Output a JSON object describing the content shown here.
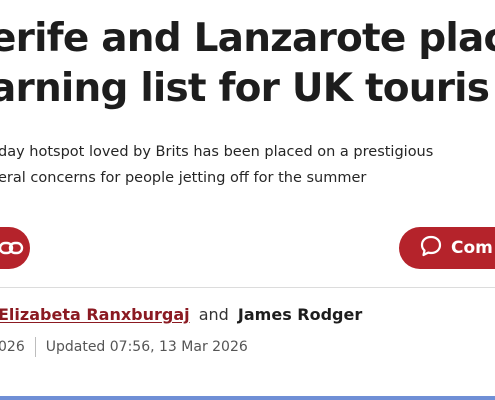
{
  "article": {
    "headline_lines": [
      "erife and Lanzarote plac",
      "arning list for UK touris"
    ],
    "standfirst_lines": [
      "day hotspot loved by Brits has been placed on a prestigious",
      "eral concerns for people jetting off for the summer"
    ],
    "share_icon": "link-icon",
    "comments_icon": "speech-bubble-icon",
    "comments_label": "Com",
    "byline": {
      "author1": "Elizabeta Ranxburgaj",
      "joiner": "and",
      "author2": "James Rodger"
    },
    "published_fragment": "026",
    "updated": "Updated 07:56, 13 Mar 2026"
  },
  "colors": {
    "brand_red": "#b5232b",
    "author_link": "#8b1a22",
    "bottom_bar": "#6f8fd6"
  }
}
